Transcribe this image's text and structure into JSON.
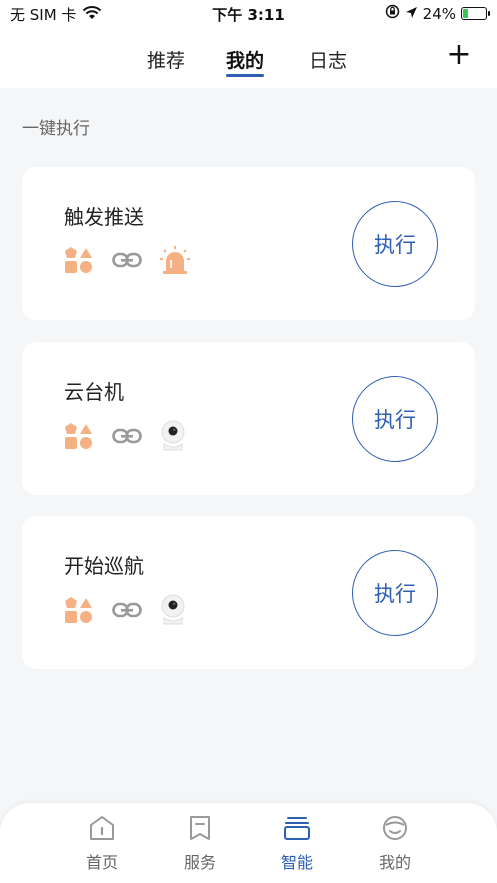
{
  "status_bar": {
    "carrier": "无 SIM 卡",
    "time": "下午 3:11",
    "battery_percent": "24%",
    "battery_level": 0.24,
    "icons": [
      "wifi-icon",
      "orientation-lock-icon",
      "location-arrow-icon",
      "battery-charging-icon"
    ]
  },
  "top_nav": {
    "tabs": [
      {
        "label": "推荐",
        "active": false
      },
      {
        "label": "我的",
        "active": true
      },
      {
        "label": "日志",
        "active": false
      }
    ],
    "plus_label": "+"
  },
  "section": {
    "title": "一键执行"
  },
  "scenes": [
    {
      "title": "触发推送",
      "execute_label": "执行",
      "device_icon": "alarm-siren-icon"
    },
    {
      "title": "云台机",
      "execute_label": "执行",
      "device_icon": "ptz-camera-icon"
    },
    {
      "title": "开始巡航",
      "execute_label": "执行",
      "device_icon": "ptz-camera-icon"
    }
  ],
  "colors": {
    "accent": "#2d5fb3",
    "scene_icon": "#f5b183",
    "background": "#f5f6f8"
  },
  "bottom_nav": {
    "items": [
      {
        "label": "首页",
        "icon": "home-icon",
        "active": false
      },
      {
        "label": "服务",
        "icon": "bookmark-icon",
        "active": false
      },
      {
        "label": "智能",
        "icon": "smart-stack-icon",
        "active": true
      },
      {
        "label": "我的",
        "icon": "smiley-icon",
        "active": false
      }
    ]
  }
}
